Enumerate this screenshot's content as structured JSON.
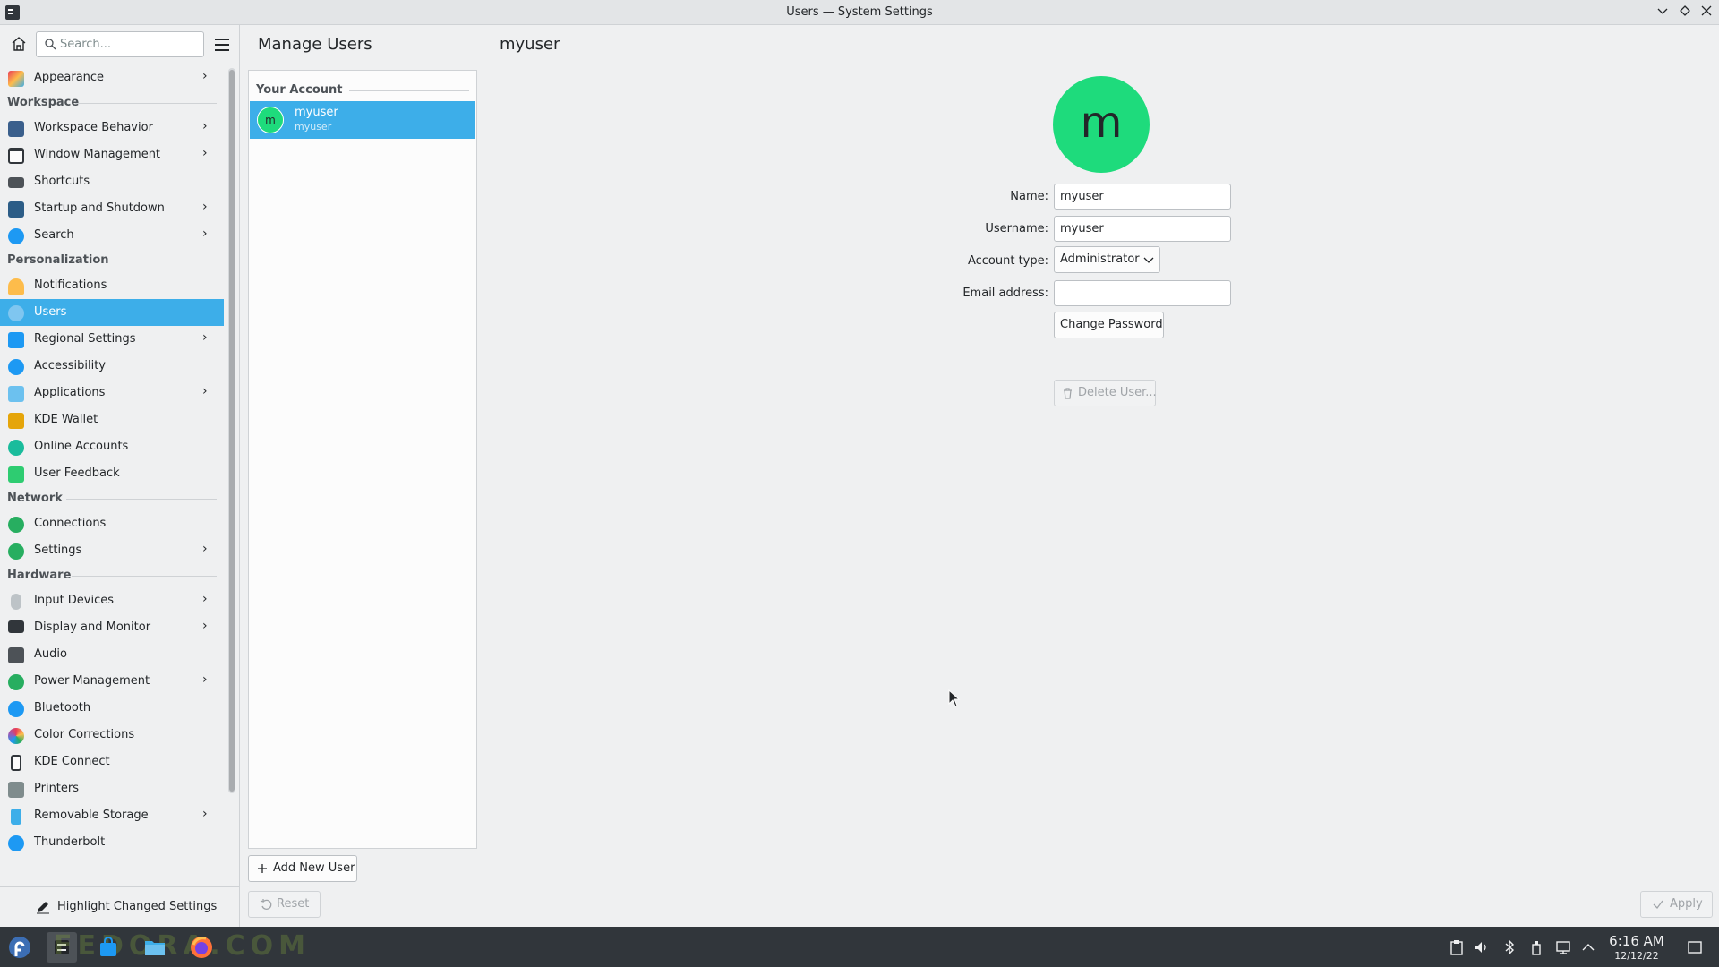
{
  "window": {
    "title": "Users — System Settings"
  },
  "sidebar": {
    "search_placeholder": "Search...",
    "highlight_label": "Highlight Changed Settings",
    "categories": {
      "workspace": "Workspace",
      "personalization": "Personalization",
      "network": "Network",
      "hardware": "Hardware"
    },
    "items": {
      "appearance": "Appearance",
      "workspace_behavior": "Workspace Behavior",
      "window_management": "Window Management",
      "shortcuts": "Shortcuts",
      "startup_shutdown": "Startup and Shutdown",
      "search": "Search",
      "notifications": "Notifications",
      "users": "Users",
      "regional_settings": "Regional Settings",
      "accessibility": "Accessibility",
      "applications": "Applications",
      "kde_wallet": "KDE Wallet",
      "online_accounts": "Online Accounts",
      "user_feedback": "User Feedback",
      "connections": "Connections",
      "settings": "Settings",
      "input_devices": "Input Devices",
      "display_monitor": "Display and Monitor",
      "audio": "Audio",
      "power_management": "Power Management",
      "bluetooth": "Bluetooth",
      "color_corrections": "Color Corrections",
      "kde_connect": "KDE Connect",
      "printers": "Printers",
      "removable_storage": "Removable Storage",
      "thunderbolt": "Thunderbolt"
    },
    "active_item": "Users"
  },
  "main": {
    "header_title": "Manage Users",
    "header_user": "myuser",
    "user_list": {
      "section_label": "Your Account",
      "users": [
        {
          "name": "myuser",
          "username": "myuser",
          "initial": "m"
        }
      ]
    },
    "add_user_label": "Add New User",
    "reset_label": "Reset",
    "apply_label": "Apply",
    "details": {
      "avatar_initial": "m",
      "name_label": "Name:",
      "name_value": "myuser",
      "username_label": "Username:",
      "username_value": "myuser",
      "account_type_label": "Account type:",
      "account_type_value": "Administrator",
      "email_label": "Email address:",
      "email_value": "",
      "change_password_label": "Change Password",
      "delete_user_label": "Delete User..."
    }
  },
  "taskbar": {
    "time": "6:16 AM",
    "date": "12/12/22",
    "watermark": "FEDORA.COM"
  },
  "colors": {
    "accent": "#3daee9",
    "avatar": "#1edb7c",
    "panel": "#31363b"
  }
}
